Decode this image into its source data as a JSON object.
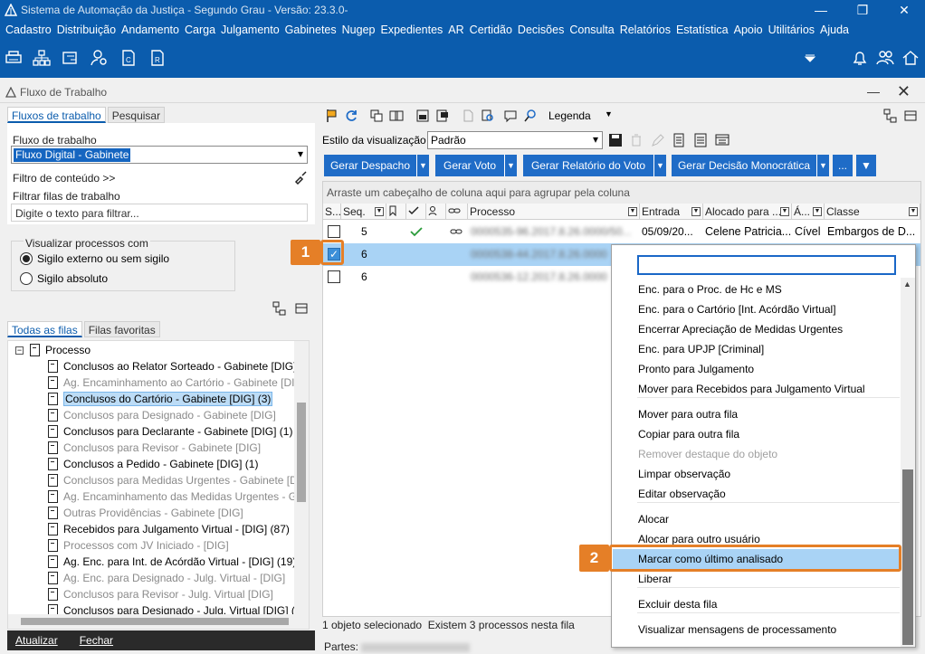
{
  "window": {
    "title": "Sistema de Automação da Justiça - Segundo Grau - Versão: 23.3.0-",
    "min": "—",
    "restore": "❐",
    "close": "✕"
  },
  "menu": [
    "Cadastro",
    "Distribuição",
    "Andamento",
    "Carga",
    "Julgamento",
    "Gabinetes",
    "Nugep",
    "Expedientes",
    "AR",
    "Certidão",
    "Decisões",
    "Consulta",
    "Relatórios",
    "Estatística",
    "Apoio",
    "Utilitários",
    "Ajuda"
  ],
  "panel": {
    "title": "Fluxo de Trabalho"
  },
  "left": {
    "tabs": [
      "Fluxos de trabalho",
      "Pesquisar"
    ],
    "flow_label": "Fluxo de trabalho",
    "flow_value": "Fluxo Digital - Gabinete",
    "content_filter": "Filtro de conteúdo >>",
    "queue_filter_label": "Filtrar filas de trabalho",
    "queue_filter_placeholder": "Digite o texto para filtrar...",
    "view_group_label": "Visualizar processos com",
    "radio1": "Sigilo externo ou sem sigilo",
    "radio2": "Sigilo absoluto",
    "tree_tabs": [
      "Todas as filas",
      "Filas favoritas"
    ],
    "tree_root": "Processo",
    "tree_items": [
      {
        "label": "Conclusos ao Relator Sorteado - Gabinete [DIG] (3",
        "dim": false,
        "selected": false
      },
      {
        "label": "Ag. Encaminhamento ao Cartório - Gabinete [DIG]",
        "dim": true,
        "selected": false
      },
      {
        "label": "Conclusos do Cartório - Gabinete [DIG] (3)",
        "dim": false,
        "selected": true
      },
      {
        "label": "Conclusos para Designado - Gabinete [DIG]",
        "dim": true,
        "selected": false
      },
      {
        "label": "Conclusos para Declarante - Gabinete [DIG] (1)",
        "dim": false,
        "selected": false
      },
      {
        "label": "Conclusos para Revisor - Gabinete [DIG]",
        "dim": true,
        "selected": false
      },
      {
        "label": "Conclusos a Pedido - Gabinete [DIG] (1)",
        "dim": false,
        "selected": false
      },
      {
        "label": "Conclusos para Medidas Urgentes - Gabinete [DIG",
        "dim": true,
        "selected": false
      },
      {
        "label": "Ag. Encaminhamento das Medidas Urgentes - Gab",
        "dim": true,
        "selected": false
      },
      {
        "label": "Outras Providências - Gabinete [DIG]",
        "dim": true,
        "selected": false
      },
      {
        "label": "Recebidos para Julgamento Virtual - [DIG] (87)",
        "dim": false,
        "selected": false
      },
      {
        "label": "Processos com JV Iniciado - [DIG]",
        "dim": true,
        "selected": false
      },
      {
        "label": "Ag. Enc. para Int. de Acórdão Virtual - [DIG] (19)",
        "dim": false,
        "selected": false
      },
      {
        "label": "Ag. Enc. para Designado - Julg. Virtual - [DIG]",
        "dim": true,
        "selected": false
      },
      {
        "label": "Conclusos para Revisor - Julg. Virtual [DIG]",
        "dim": true,
        "selected": false
      },
      {
        "label": "Conclusos para Designado - Julg. Virtual [DIG] (5",
        "dim": false,
        "selected": false
      }
    ],
    "bottom": [
      "Atualizar",
      "Fechar"
    ]
  },
  "right": {
    "legend": "Legenda",
    "style_label": "Estilo da visualização",
    "style_value": "Padrão",
    "buttons": [
      "Gerar Despacho",
      "Gerar Voto",
      "Gerar Relatório do Voto",
      "Gerar Decisão Monocrática",
      "..."
    ],
    "group_hint": "Arraste um cabeçalho de coluna aqui para agrupar pela coluna",
    "columns": [
      "S...",
      "Seq.",
      "",
      "",
      "",
      "Processo",
      "Entrada",
      "Alocado para ...",
      "Á...",
      "Classe"
    ],
    "rows": [
      {
        "seq": "5",
        "checked": false,
        "selected": false,
        "processo": "0000535-96.2017.8.26.0000/50...",
        "entrada": "05/09/20...",
        "alocado": "Celene Patricia...",
        "area": "Cível",
        "classe": "Embargos de D..."
      },
      {
        "seq": "6",
        "checked": true,
        "selected": true,
        "processo": "0000538-44.2017.8.26.0000",
        "entrada": "",
        "alocado": "",
        "area": "",
        "classe": ""
      },
      {
        "seq": "6",
        "checked": false,
        "selected": false,
        "processo": "0000536-12.2017.8.26.0000",
        "entrada": "",
        "alocado": "",
        "area": "",
        "classe": ""
      }
    ],
    "status_selected": "1 objeto selecionado",
    "status_count": "Existem 3 processos nesta fila",
    "partes_label": "Partes:"
  },
  "context_menu": {
    "items": [
      {
        "label": "Enc. para o Proc. de Hc e MS",
        "disabled": false
      },
      {
        "label": "Enc. para o Cartório [Int. Acórdão Virtual]",
        "disabled": false
      },
      {
        "label": "Encerrar Apreciação de Medidas Urgentes",
        "disabled": false
      },
      {
        "label": "Enc. para UPJP [Criminal]",
        "disabled": false
      },
      {
        "label": "Pronto para Julgamento",
        "disabled": false
      },
      {
        "label": "Mover para Recebidos para Julgamento Virtual",
        "disabled": false
      },
      {
        "label": "Mover para outra fila",
        "disabled": false
      },
      {
        "label": "Copiar para outra fila",
        "disabled": false
      },
      {
        "label": "Remover destaque do objeto",
        "disabled": true
      },
      {
        "label": "Limpar observação",
        "disabled": false
      },
      {
        "label": "Editar observação",
        "disabled": false
      },
      {
        "label": "Alocar",
        "disabled": false
      },
      {
        "label": "Alocar para outro usuário",
        "disabled": false
      },
      {
        "label": "Marcar como último analisado",
        "disabled": false
      },
      {
        "label": "Liberar",
        "disabled": false
      },
      {
        "label": "Excluir desta fila",
        "disabled": false
      },
      {
        "label": "Visualizar mensagens de processamento",
        "disabled": false
      }
    ]
  },
  "callouts": [
    "1",
    "2"
  ],
  "colors": {
    "brand": "#0b5cad",
    "button": "#1f6cc7",
    "accent": "#e57f27",
    "selection": "#a9d3f5"
  }
}
